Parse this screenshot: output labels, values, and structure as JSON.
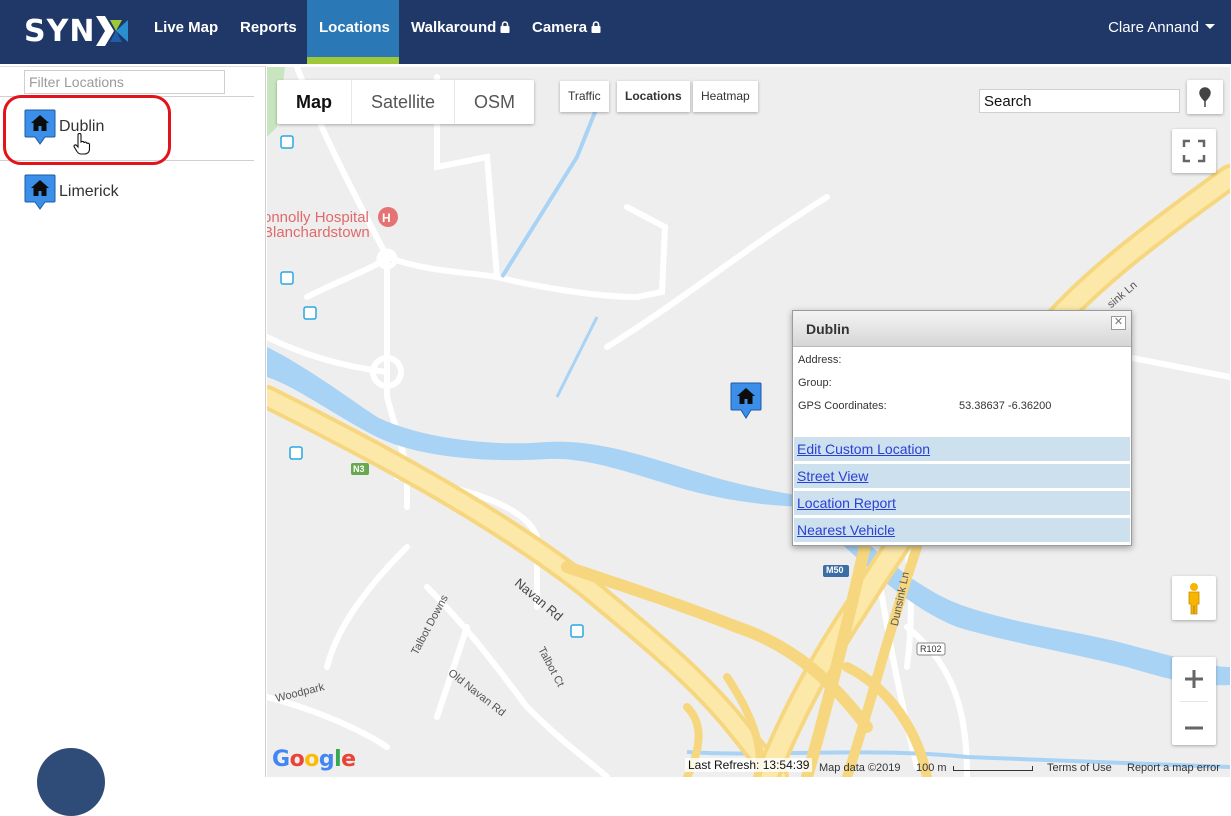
{
  "nav": {
    "logo": "SYN",
    "items": [
      {
        "label": "Live Map"
      },
      {
        "label": "Reports"
      },
      {
        "label": "Locations"
      },
      {
        "label": "Walkaround"
      },
      {
        "label": "Camera"
      }
    ],
    "user": "Clare Annand",
    "colors": {
      "bar": "#1f3868",
      "active": "#2a79b6",
      "accent": "#9cc83a"
    }
  },
  "sidebar": {
    "filter_placeholder": "Filter Locations",
    "locations": [
      {
        "name": "Dublin",
        "icon": "home-pin-icon"
      },
      {
        "name": "Limerick",
        "icon": "home-pin-icon"
      }
    ]
  },
  "map": {
    "types": [
      "Map",
      "Satellite",
      "OSM"
    ],
    "selected_type": "Map",
    "layers": [
      "Traffic",
      "Locations",
      "Heatmap"
    ],
    "selected_layer": "Locations",
    "search_value": "Search",
    "labels": {
      "hospital_line1": "onnolly Hospital",
      "hospital_line2": "Blanchardstown",
      "navan_rd": "Navan Rd",
      "talbot_downs": "Talbot Downs",
      "old_navan_rd": "Old Navan Rd",
      "talbot_ct": "Talbot Ct",
      "woodpark": "Woodpark",
      "dunsink_ln": "Dunsink Ln",
      "dunsink_ln_top": "sink Ln",
      "n3": "N3",
      "m50": "M50",
      "r102": "R102"
    },
    "info_window": {
      "title": "Dublin",
      "address_label": "Address:",
      "group_label": "Group:",
      "gps_label": "GPS Coordinates:",
      "gps_value": "53.38637 -6.36200",
      "links": [
        "Edit Custom Location",
        "Street View",
        "Location Report",
        "Nearest Vehicle"
      ]
    },
    "footer": {
      "last_refresh_label": "Last Refresh:",
      "last_refresh_time": "13:54:39",
      "map_data": "Map data ©2019",
      "scale": "100 m",
      "terms": "Terms of Use",
      "report": "Report a map error",
      "google": "Google"
    }
  }
}
